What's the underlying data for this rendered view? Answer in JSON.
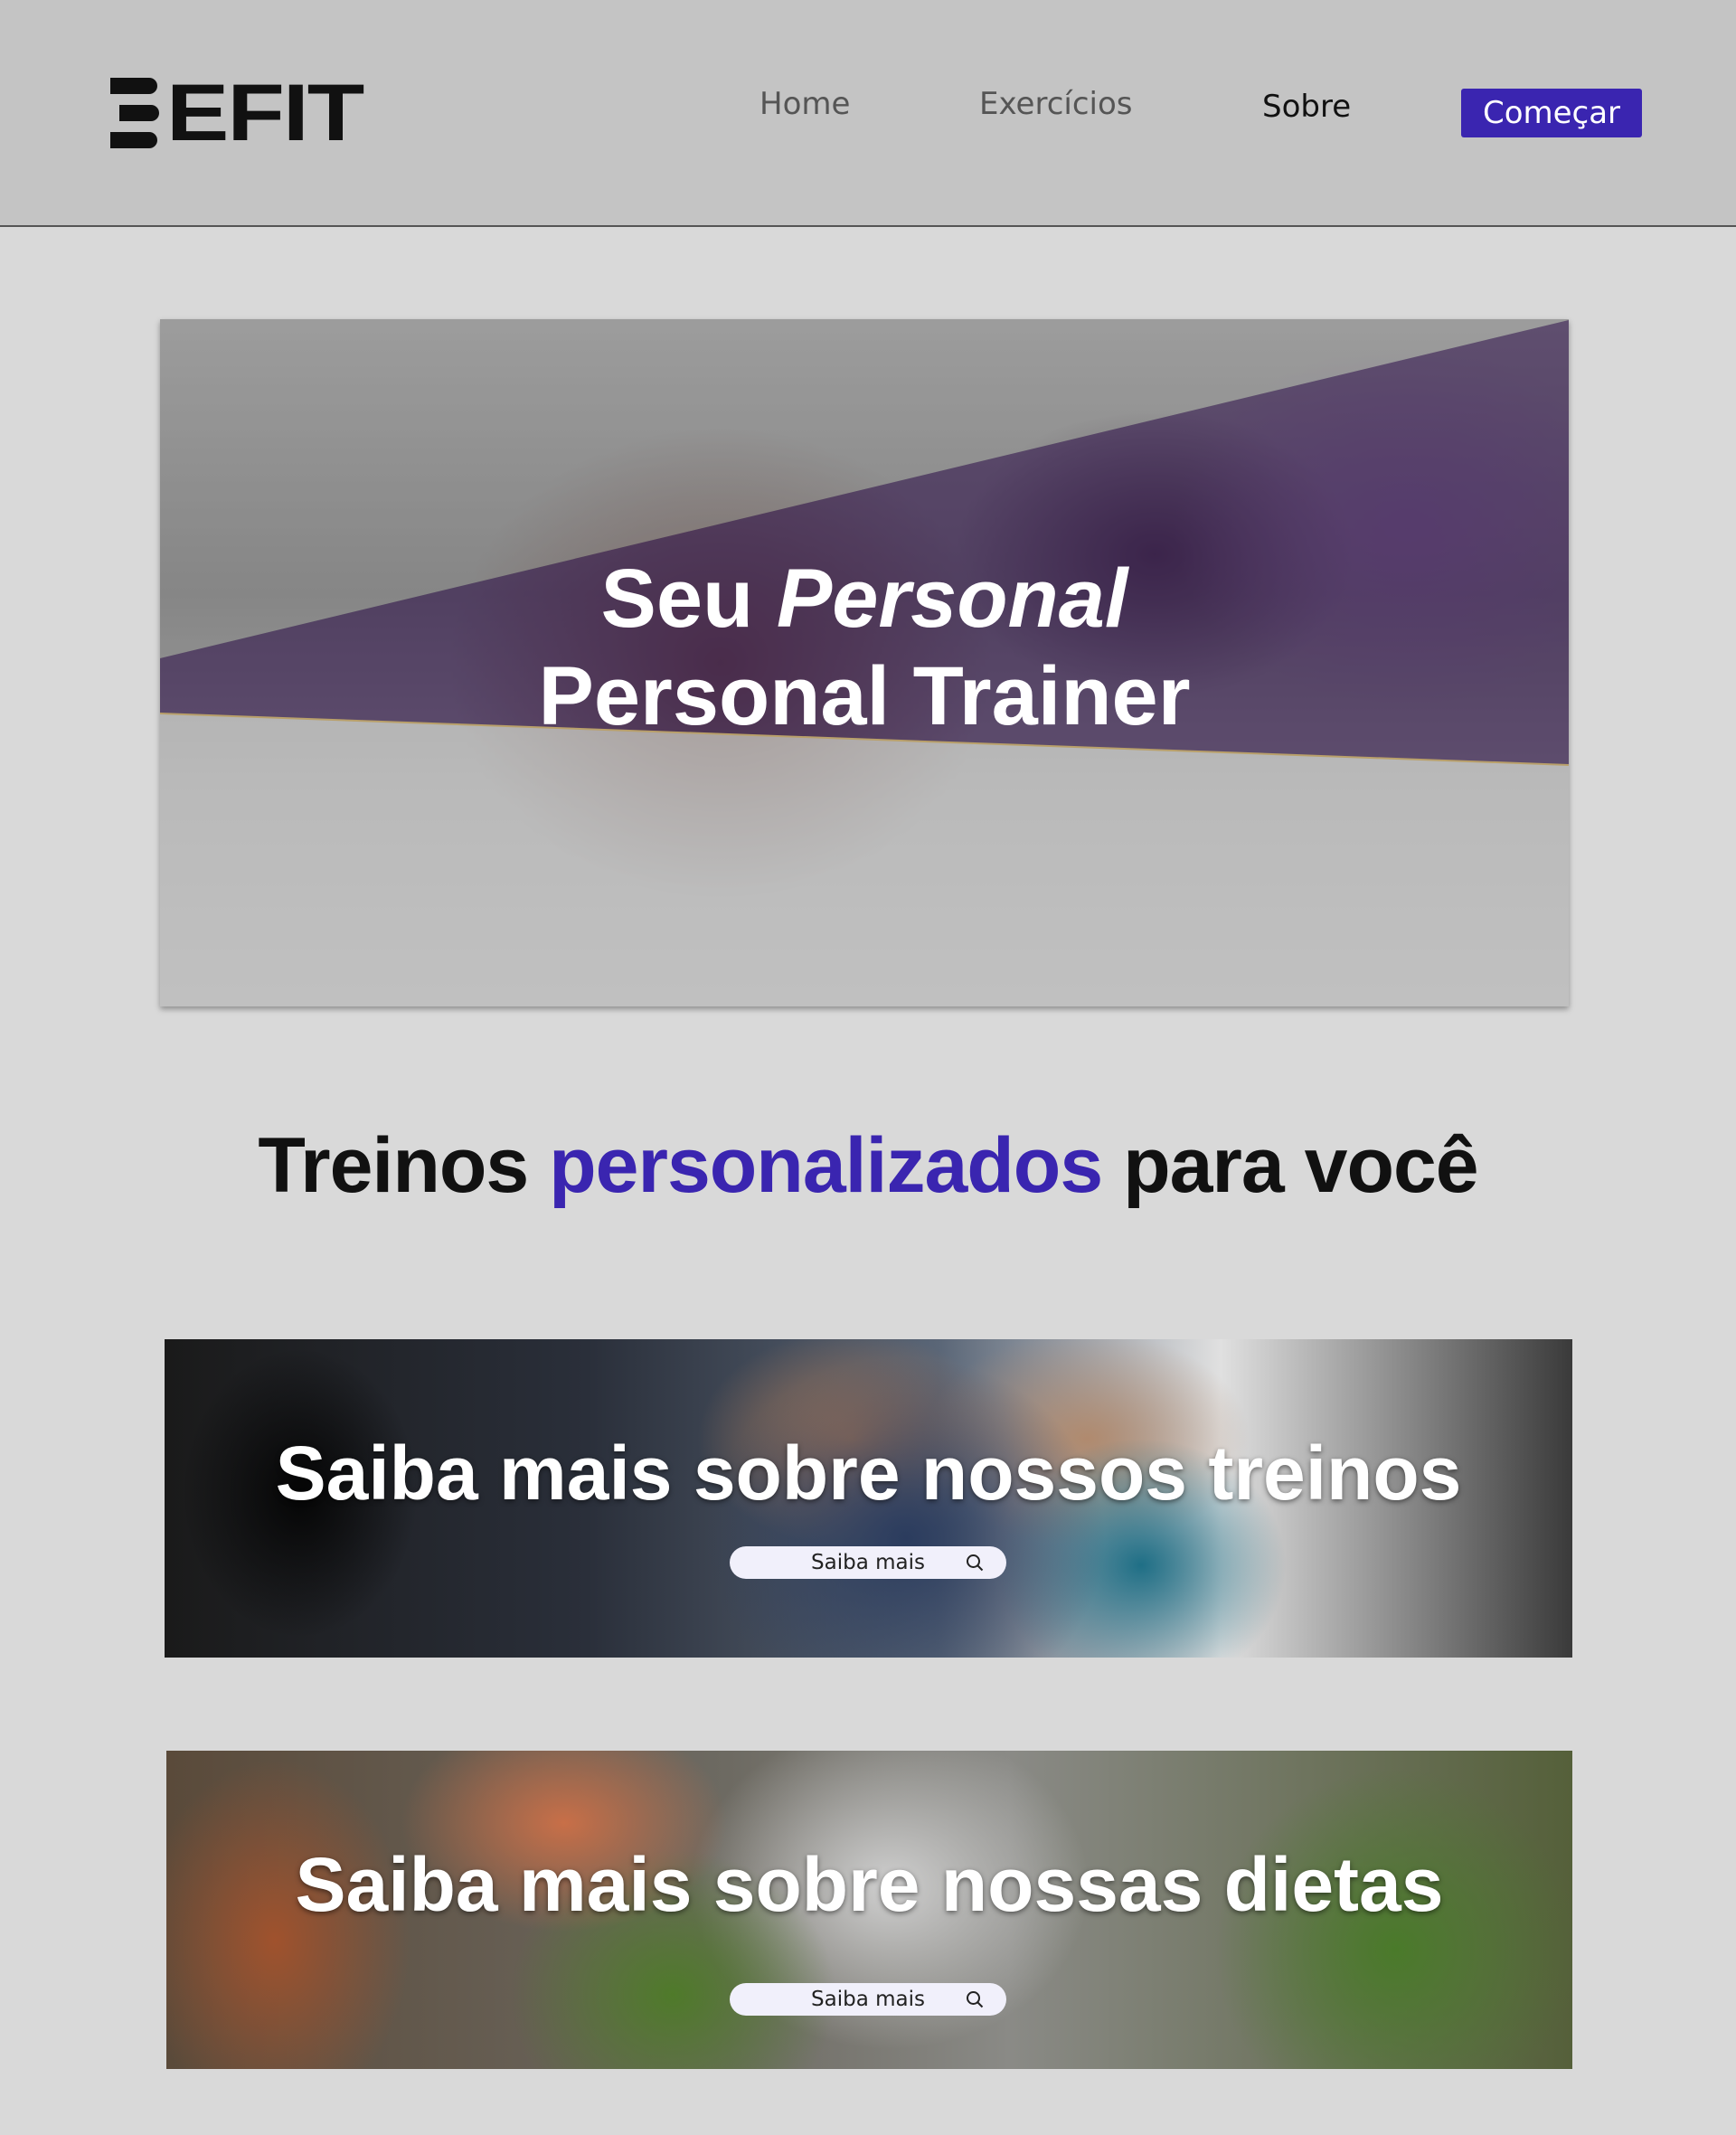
{
  "header": {
    "logo_text": "EFIT",
    "nav": [
      "Home",
      "Exercícios",
      "Sobre"
    ],
    "cta_label": "Começar"
  },
  "hero": {
    "line1_plain": "Seu ",
    "line1_italic": "Personal",
    "line2": "Personal Trainer"
  },
  "section": {
    "heading_before": "Treinos ",
    "heading_accent": "personalizados",
    "heading_after": " para você"
  },
  "banners": [
    {
      "title": "Saiba mais sobre nossos treinos",
      "button_label": "Saiba mais"
    },
    {
      "title": "Saiba mais sobre nossas dietas",
      "button_label": "Saiba mais"
    }
  ],
  "colors": {
    "accent": "#3a25b0",
    "header_bg": "#c4c4c4",
    "page_bg": "#d9d9d9"
  }
}
